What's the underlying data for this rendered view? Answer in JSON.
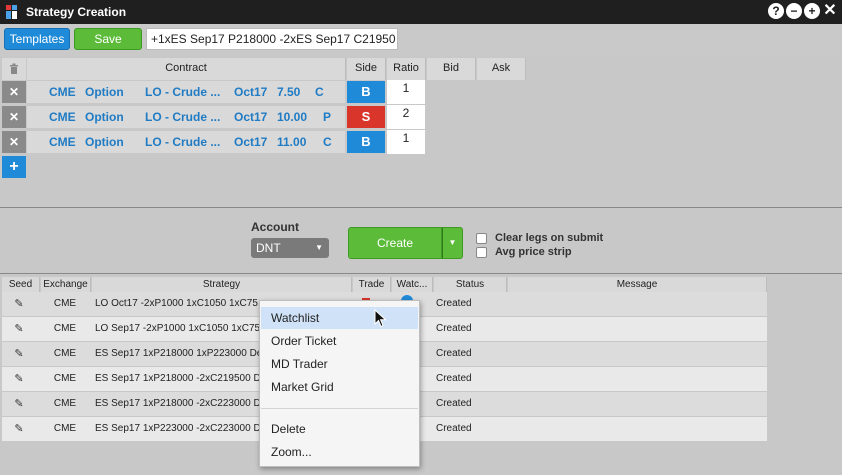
{
  "window": {
    "title": "Strategy Creation",
    "buttons": [
      "?",
      "−",
      "+",
      "✕"
    ]
  },
  "toolbar": {
    "templates_label": "Templates",
    "save_label": "Save",
    "strategy_value": "+1xES Sep17 P218000 -2xES Sep17 C21950"
  },
  "legs_table": {
    "columns": [
      "Contract",
      "Side",
      "Ratio",
      "Bid",
      "Ask"
    ],
    "rows": [
      {
        "exchange": "CME",
        "type": "Option",
        "product": "LO - Crude ...",
        "month": "Oct17",
        "strike": "7.50",
        "cp": "C",
        "side": "B",
        "ratio": "1"
      },
      {
        "exchange": "CME",
        "type": "Option",
        "product": "LO - Crude ...",
        "month": "Oct17",
        "strike": "10.00",
        "cp": "P",
        "side": "S",
        "ratio": "2"
      },
      {
        "exchange": "CME",
        "type": "Option",
        "product": "LO - Crude ...",
        "month": "Oct17",
        "strike": "11.00",
        "cp": "C",
        "side": "B",
        "ratio": "1"
      }
    ],
    "add_label": "+",
    "remove_label": "✕"
  },
  "submit": {
    "account_label": "Account",
    "account_value": "DNT",
    "create_label": "Create",
    "clear_legs_label": "Clear legs on submit",
    "avg_price_label": "Avg price strip"
  },
  "strategies_grid": {
    "columns": [
      "Seed",
      "Exchange",
      "Strategy",
      "Trade",
      "Watc...",
      "Status",
      "Message"
    ],
    "rows": [
      {
        "exchange": "CME",
        "strategy": "LO Oct17 -2xP1000 1xC1050 1xC75",
        "status": "Created"
      },
      {
        "exchange": "CME",
        "strategy": "LO Sep17 -2xP1000 1xC1050 1xC75",
        "status": "Created"
      },
      {
        "exchange": "CME",
        "strategy": "ES Sep17 1xP218000 1xP223000 De",
        "status": "Created"
      },
      {
        "exchange": "CME",
        "strategy": "ES Sep17 1xP218000 -2xC219500 D",
        "status": "Created"
      },
      {
        "exchange": "CME",
        "strategy": "ES Sep17 1xP218000 -2xC223000 D",
        "status": "Created"
      },
      {
        "exchange": "CME",
        "strategy": "ES Sep17 1xP223000 -2xC223000 D",
        "status": "Created"
      }
    ]
  },
  "context_menu": {
    "items": [
      "Watchlist",
      "Order Ticket",
      "MD Trader",
      "Market Grid"
    ],
    "items2": [
      "Delete",
      "Zoom..."
    ],
    "highlighted": "Watchlist"
  },
  "colors": {
    "accent_blue": "#1f8ad8",
    "accent_green": "#5cbc3a",
    "sell_red": "#d9352a",
    "buy_blue": "#1f8ad8"
  },
  "icons": {
    "trash": "trash-icon",
    "remove": "close-icon",
    "add": "plus-icon",
    "edit": "pencil-icon",
    "cursor": "pointer-cursor-icon"
  }
}
